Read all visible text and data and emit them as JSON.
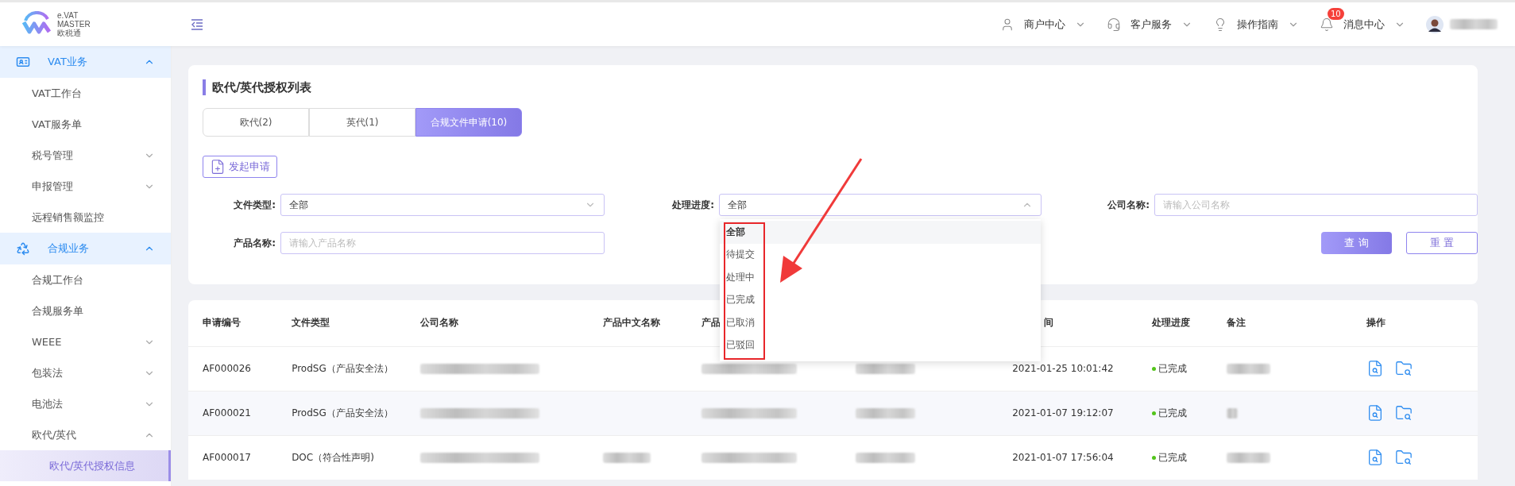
{
  "header": {
    "logo": {
      "line1": "e.VAT",
      "line2": "MASTER",
      "line3": "欧税通"
    },
    "nav": [
      {
        "kind": "user",
        "label": "商户中心"
      },
      {
        "kind": "service",
        "label": "客户服务"
      },
      {
        "kind": "guide",
        "label": "操作指南"
      },
      {
        "kind": "bell",
        "label": "消息中心",
        "badge": "10"
      }
    ]
  },
  "sidebar": {
    "items": [
      {
        "kind": "group",
        "label": "VAT业务",
        "expanded": true,
        "selected": false,
        "children": [
          {
            "kind": "item",
            "label": "VAT工作台",
            "selected": false
          },
          {
            "kind": "item",
            "label": "VAT服务单",
            "selected": false
          },
          {
            "kind": "submenu",
            "label": "税号管理",
            "expanded": false,
            "selected": false
          },
          {
            "kind": "submenu",
            "label": "申报管理",
            "expanded": false,
            "selected": false
          },
          {
            "kind": "item",
            "label": "远程销售额监控",
            "selected": false
          }
        ]
      },
      {
        "kind": "group",
        "label": "合规业务",
        "expanded": true,
        "selected": false,
        "children": [
          {
            "kind": "item",
            "label": "合规工作台",
            "selected": false
          },
          {
            "kind": "item",
            "label": "合规服务单",
            "selected": false
          },
          {
            "kind": "submenu",
            "label": "WEEE",
            "expanded": false,
            "selected": false
          },
          {
            "kind": "submenu",
            "label": "包装法",
            "expanded": false,
            "selected": false
          },
          {
            "kind": "submenu",
            "label": "电池法",
            "expanded": false,
            "selected": false
          },
          {
            "kind": "submenu",
            "label": "欧代/英代",
            "expanded": true,
            "selected": false,
            "children": [
              {
                "kind": "item",
                "label": "欧代/英代授权信息",
                "selected": true
              }
            ]
          }
        ]
      }
    ]
  },
  "page": {
    "title": "欧代/英代授权列表",
    "tabs": [
      {
        "label": "欧代(2)",
        "selected": false
      },
      {
        "label": "英代(1)",
        "selected": false
      },
      {
        "label": "合规文件申请(10)",
        "selected": true
      }
    ],
    "apply_button": "发起申请",
    "filters": [
      {
        "kind": "select",
        "label": "文件类型:",
        "value": "全部",
        "expanded": false
      },
      {
        "kind": "select",
        "label": "处理进度:",
        "value": "全部",
        "expanded": true,
        "options": [
          {
            "label": "全部",
            "selected": true
          },
          {
            "label": "待提交",
            "selected": false
          },
          {
            "label": "处理中",
            "selected": false
          },
          {
            "label": "已完成",
            "selected": false
          },
          {
            "label": "已取消",
            "selected": false
          },
          {
            "label": "已驳回",
            "selected": false
          }
        ]
      },
      {
        "kind": "input",
        "label": "公司名称:",
        "placeholder": "请输入公司名称"
      },
      {
        "kind": "input",
        "label": "产品名称:",
        "placeholder": "请输入产品名称"
      }
    ],
    "query_button": "查 询",
    "reset_button": "重 置",
    "annotation": {
      "box": true,
      "arrow": true
    }
  },
  "table": {
    "columns": [
      "申请编号",
      "文件类型",
      "公司名称",
      "产品中文名称",
      "产品",
      "",
      "间",
      "处理进度",
      "备注",
      "操作"
    ],
    "rows": [
      {
        "cells": [
          {
            "kind": "text",
            "text": "AF000026"
          },
          {
            "kind": "text",
            "text": "ProdSG（产品安全法）"
          },
          {
            "kind": "redacted"
          },
          {
            "kind": "empty"
          },
          {
            "kind": "redacted"
          },
          {
            "kind": "redacted"
          },
          {
            "kind": "text",
            "text": "2021-01-25 10:01:42"
          },
          {
            "kind": "status",
            "text": "已完成",
            "color": "#52c41a"
          },
          {
            "kind": "redacted"
          },
          {
            "kind": "actions"
          }
        ]
      },
      {
        "cells": [
          {
            "kind": "text",
            "text": "AF000021"
          },
          {
            "kind": "text",
            "text": "ProdSG（产品安全法）"
          },
          {
            "kind": "redacted"
          },
          {
            "kind": "empty"
          },
          {
            "kind": "redacted"
          },
          {
            "kind": "redacted"
          },
          {
            "kind": "text",
            "text": "2021-01-07 19:12:07"
          },
          {
            "kind": "status",
            "text": "已完成",
            "color": "#52c41a"
          },
          {
            "kind": "redacted"
          },
          {
            "kind": "actions"
          }
        ]
      },
      {
        "cells": [
          {
            "kind": "text",
            "text": "AF000017"
          },
          {
            "kind": "text",
            "text": "DOC（符合性声明)"
          },
          {
            "kind": "redacted"
          },
          {
            "kind": "redacted"
          },
          {
            "kind": "redacted"
          },
          {
            "kind": "redacted"
          },
          {
            "kind": "text",
            "text": "2021-01-07 17:56:04"
          },
          {
            "kind": "status",
            "text": "已完成",
            "color": "#52c41a"
          },
          {
            "kind": "redacted"
          },
          {
            "kind": "actions"
          }
        ]
      }
    ]
  }
}
